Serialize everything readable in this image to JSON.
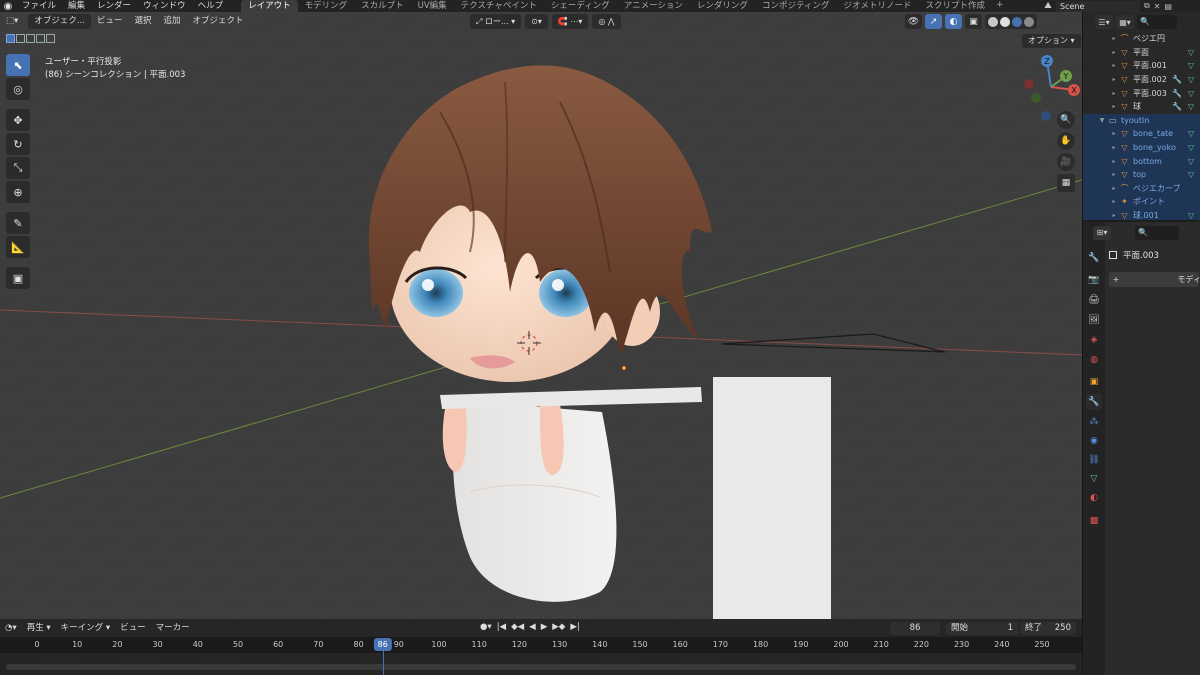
{
  "topbar": {
    "menus": [
      "ファイル",
      "編集",
      "レンダー",
      "ウィンドウ",
      "ヘルプ"
    ],
    "workspace_tabs": [
      "レイアウト",
      "モデリング",
      "スカルプト",
      "UV編集",
      "テクスチャペイント",
      "シェーディング",
      "アニメーション",
      "レンダリング",
      "コンポジティング",
      "ジオメトリノード",
      "スクリプト作成"
    ],
    "active_tab": "レイアウト",
    "scene": "Scene"
  },
  "viewport": {
    "mode": "オブジェク...",
    "header_menus": [
      "ビュー",
      "選択",
      "追加",
      "オブジェクト"
    ],
    "transform_orientation": "ロー...",
    "options_label": "オプション",
    "view_label": "ユーザー・平行投影",
    "collection_label": "(86) シーンコレクション | 平面.003",
    "gizmo_axes": [
      "X",
      "Y",
      "Z"
    ]
  },
  "timeline": {
    "menus": [
      "再生",
      "キーイング",
      "ビュー",
      "マーカー"
    ],
    "current_frame": "86",
    "start_label": "開始",
    "start_value": "1",
    "end_label": "終了",
    "end_value": "250",
    "ticks": [
      0,
      10,
      20,
      30,
      40,
      50,
      60,
      70,
      80,
      90,
      100,
      110,
      120,
      130,
      140,
      150,
      160,
      170,
      180,
      190,
      200,
      210,
      220,
      230,
      240,
      250
    ]
  },
  "outliner": {
    "rows": [
      {
        "label": "ベジエ円",
        "icon": "curve-icon",
        "selected": false
      },
      {
        "label": "平面",
        "icon": "mesh-icon",
        "selected": false
      },
      {
        "label": "平面.001",
        "icon": "mesh-icon",
        "selected": false
      },
      {
        "label": "平面.002",
        "icon": "mesh-icon",
        "selected": false
      },
      {
        "label": "平面.003",
        "icon": "mesh-icon",
        "selected": false
      },
      {
        "label": "球",
        "icon": "mesh-icon",
        "selected": false
      },
      {
        "label": "tyoutin",
        "icon": "collection-icon",
        "selected": true
      },
      {
        "label": "bone_tate",
        "icon": "mesh-icon",
        "selected": true
      },
      {
        "label": "bone_yoko",
        "icon": "mesh-icon",
        "selected": true
      },
      {
        "label": "bottom",
        "icon": "mesh-icon",
        "selected": true
      },
      {
        "label": "top",
        "icon": "mesh-icon",
        "selected": true
      },
      {
        "label": "ベジエカーブ",
        "icon": "curve-icon",
        "selected": true
      },
      {
        "label": "ポイント",
        "icon": "light-icon",
        "selected": true
      },
      {
        "label": "球.001",
        "icon": "mesh-icon",
        "selected": true
      }
    ]
  },
  "properties": {
    "object_name": "平面.003",
    "add_modifier_label": "モディフ"
  }
}
